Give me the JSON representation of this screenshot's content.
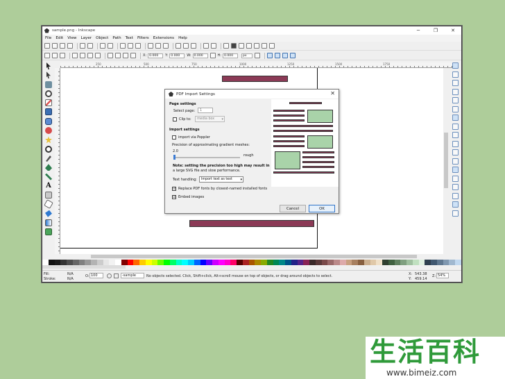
{
  "window": {
    "title": "sample.png - Inkscape",
    "controls": {
      "minimize": "─",
      "maximize": "❐",
      "close": "✕"
    }
  },
  "menu": [
    "File",
    "Edit",
    "View",
    "Layer",
    "Object",
    "Path",
    "Text",
    "Filters",
    "Extensions",
    "Help"
  ],
  "toolcontrols": {
    "x_label": "X:",
    "x_value": "0.000",
    "y_label": "Y:",
    "y_value": "0.000",
    "w_label": "W:",
    "w_value": "0.000",
    "h_label": "H:",
    "h_value": "0.000",
    "unit": "px"
  },
  "ruler": {
    "labels": [
      "250",
      "500",
      "750",
      "1000",
      "1250",
      "1500",
      "1750"
    ]
  },
  "status": {
    "fill_label": "Fill:",
    "fill_value": "N/A",
    "stroke_label": "Stroke:",
    "stroke_value": "N/A",
    "opacity_label": "O:",
    "opacity_value": "100",
    "layer": "-sample",
    "message": "No objects selected. Click, Shift+click, Alt+scroll mouse on top of objects, or drag around objects to select.",
    "x_label": "X:",
    "x_value": "543.38",
    "y_label": "Y:",
    "y_value": "459.14",
    "zoom_label": "Z:",
    "zoom_value": "54%"
  },
  "dialog": {
    "title": "PDF Import Settings",
    "page_settings": "Page settings",
    "select_page_label": "Select page:",
    "select_page_value": "1",
    "clip_to_label": "Clip to:",
    "clip_to_value": "media box",
    "import_settings": "Import settings",
    "import_poppler": "import via Poppler",
    "precision_label": "Precision of approximating gradient meshes:",
    "precision_value": "2.0",
    "precision_right": "rough",
    "note_line1": "Note: setting the precision too high may result in",
    "note_line2": "a large SVG file and slow performance.",
    "text_handling_label": "Text handling:",
    "text_handling_value": "Import text as text",
    "replace_fonts": "Replace PDF fonts by closest-named installed fonts",
    "embed_images": "Embed images",
    "cancel": "Cancel",
    "ok": "OK",
    "replace_checked": "☑",
    "embed_checked": "☑"
  },
  "watermark": {
    "chars": "生活百科",
    "url": "www.bimeiz.com"
  },
  "colors": {
    "bar": "#8b3a56",
    "green": "#a9d3a9",
    "accent": "#2f74c9"
  }
}
